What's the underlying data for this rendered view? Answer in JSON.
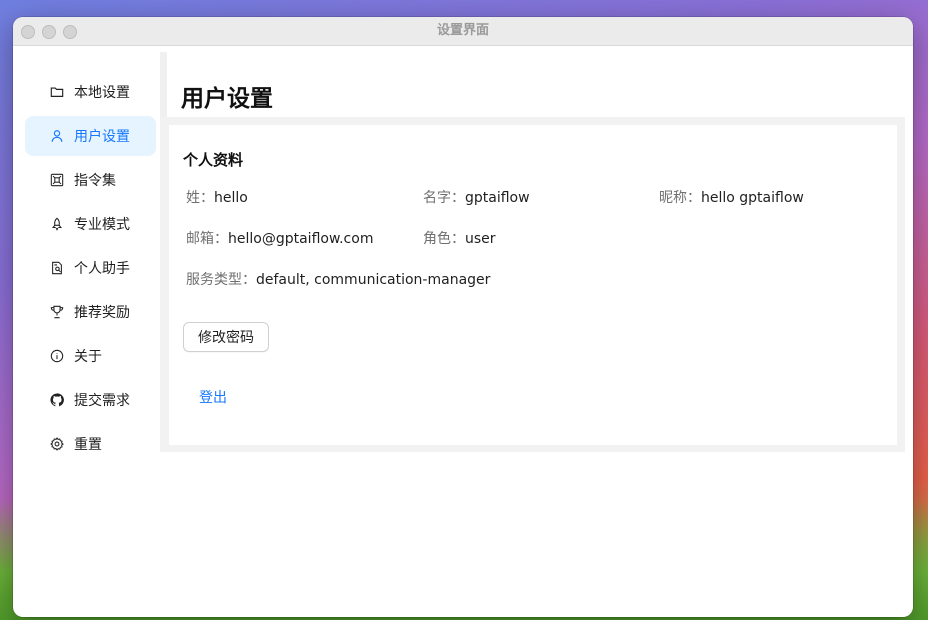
{
  "window": {
    "title": "设置界面"
  },
  "sidebar": {
    "items": [
      {
        "label": "本地设置",
        "icon": "folder-icon",
        "active": false
      },
      {
        "label": "用户设置",
        "icon": "user-icon",
        "active": true
      },
      {
        "label": "指令集",
        "icon": "command-icon",
        "active": false
      },
      {
        "label": "专业模式",
        "icon": "rocket-icon",
        "active": false
      },
      {
        "label": "个人助手",
        "icon": "file-search-icon",
        "active": false
      },
      {
        "label": "推荐奖励",
        "icon": "trophy-icon",
        "active": false
      },
      {
        "label": "关于",
        "icon": "info-icon",
        "active": false
      },
      {
        "label": "提交需求",
        "icon": "github-icon",
        "active": false
      },
      {
        "label": "重置",
        "icon": "gear-icon",
        "active": false
      }
    ]
  },
  "main": {
    "title": "用户设置",
    "profile": {
      "title": "个人资料",
      "last_name_label": "姓：",
      "last_name": "hello",
      "first_name_label": "名字：",
      "first_name": "gptaiflow",
      "nickname_label": "昵称：",
      "nickname": "hello gptaiflow",
      "email_label": "邮箱：",
      "email": "hello@gptaiflow.com",
      "role_label": "角色：",
      "role": "user",
      "service_type_label": "服务类型：",
      "service_type": "default, communication-manager",
      "change_password_label": "修改密码",
      "logout_label": "登出"
    }
  },
  "colors": {
    "accent": "#1677ff",
    "active_bg": "#e6f4ff"
  }
}
